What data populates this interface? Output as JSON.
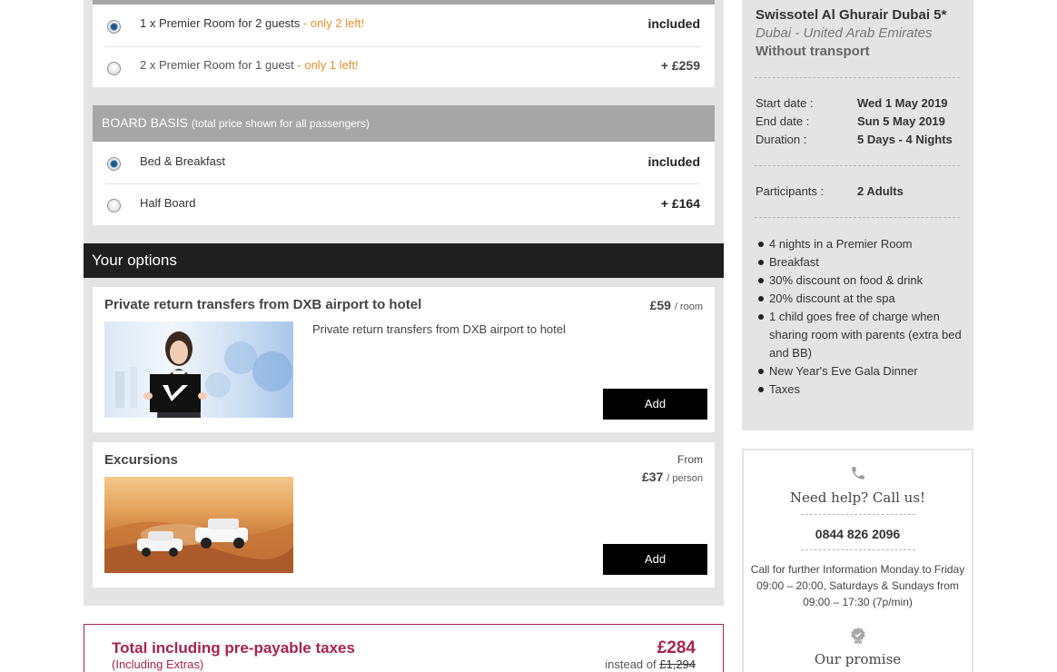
{
  "room_options": [
    {
      "label": "1 x Premier Room for 2 guests",
      "availability": " - only 2 left!",
      "price": "included",
      "selected": true
    },
    {
      "label": "2 x Premier Room for 1 guest",
      "availability": " - only 1 left!",
      "price": "+ £259",
      "selected": false
    }
  ],
  "board_basis": {
    "title": "BOARD BASIS",
    "subtitle": "(total price shown for all passengers)",
    "options": [
      {
        "label": "Bed & Breakfast",
        "price": "included",
        "selected": true
      },
      {
        "label": "Half Board",
        "price": "+ £164",
        "selected": false
      }
    ]
  },
  "your_options": {
    "title": "Your options",
    "extras": [
      {
        "title": "Private return transfers from DXB airport to hotel",
        "price": "£59",
        "unit": "/ room",
        "description": "Private return transfers from DXB airport to hotel",
        "button": "Add"
      },
      {
        "title": "Excursions",
        "from": "From",
        "price": "£37",
        "unit": "/ person",
        "button": "Add"
      }
    ]
  },
  "total": {
    "title": "Total including pre-payable taxes",
    "subtitle": "(Including Extras)",
    "price": "£284",
    "instead_label": "instead of",
    "instead_price": "£1,294"
  },
  "summary": {
    "hotel": "Swissotel Al Ghurair Dubai 5*",
    "location": "Dubai - United Arab Emirates",
    "transport": "Without transport",
    "start_label": "Start date :",
    "start_value": "Wed 1 May 2019",
    "end_label": "End date :",
    "end_value": "Sun 5 May 2019",
    "duration_label": "Duration :",
    "duration_value": "5 Days - 4 Nights",
    "participants_label": "Participants :",
    "participants_value": "2 Adults",
    "includes": [
      "4 nights in a Premier Room",
      "Breakfast",
      "30% discount on food & drink",
      "20% discount at the spa",
      "1 child goes free of charge when sharing room with parents (extra bed and BB)",
      "New Year's Eve Gala Dinner",
      "Taxes"
    ]
  },
  "help": {
    "title": "Need help? Call us!",
    "phone": "0844 826 2096",
    "info": "Call for further Information Monday to Friday 09:00 – 20:00, Saturdays & Sundays from 09:00 – 17:30 (7p/min)",
    "promise": "Our promise"
  },
  "colors": {
    "accent": "#a8234e",
    "availability": "#e8922a",
    "panel_bg": "#e4e4e4",
    "header_dark": "#1f1f1f"
  }
}
